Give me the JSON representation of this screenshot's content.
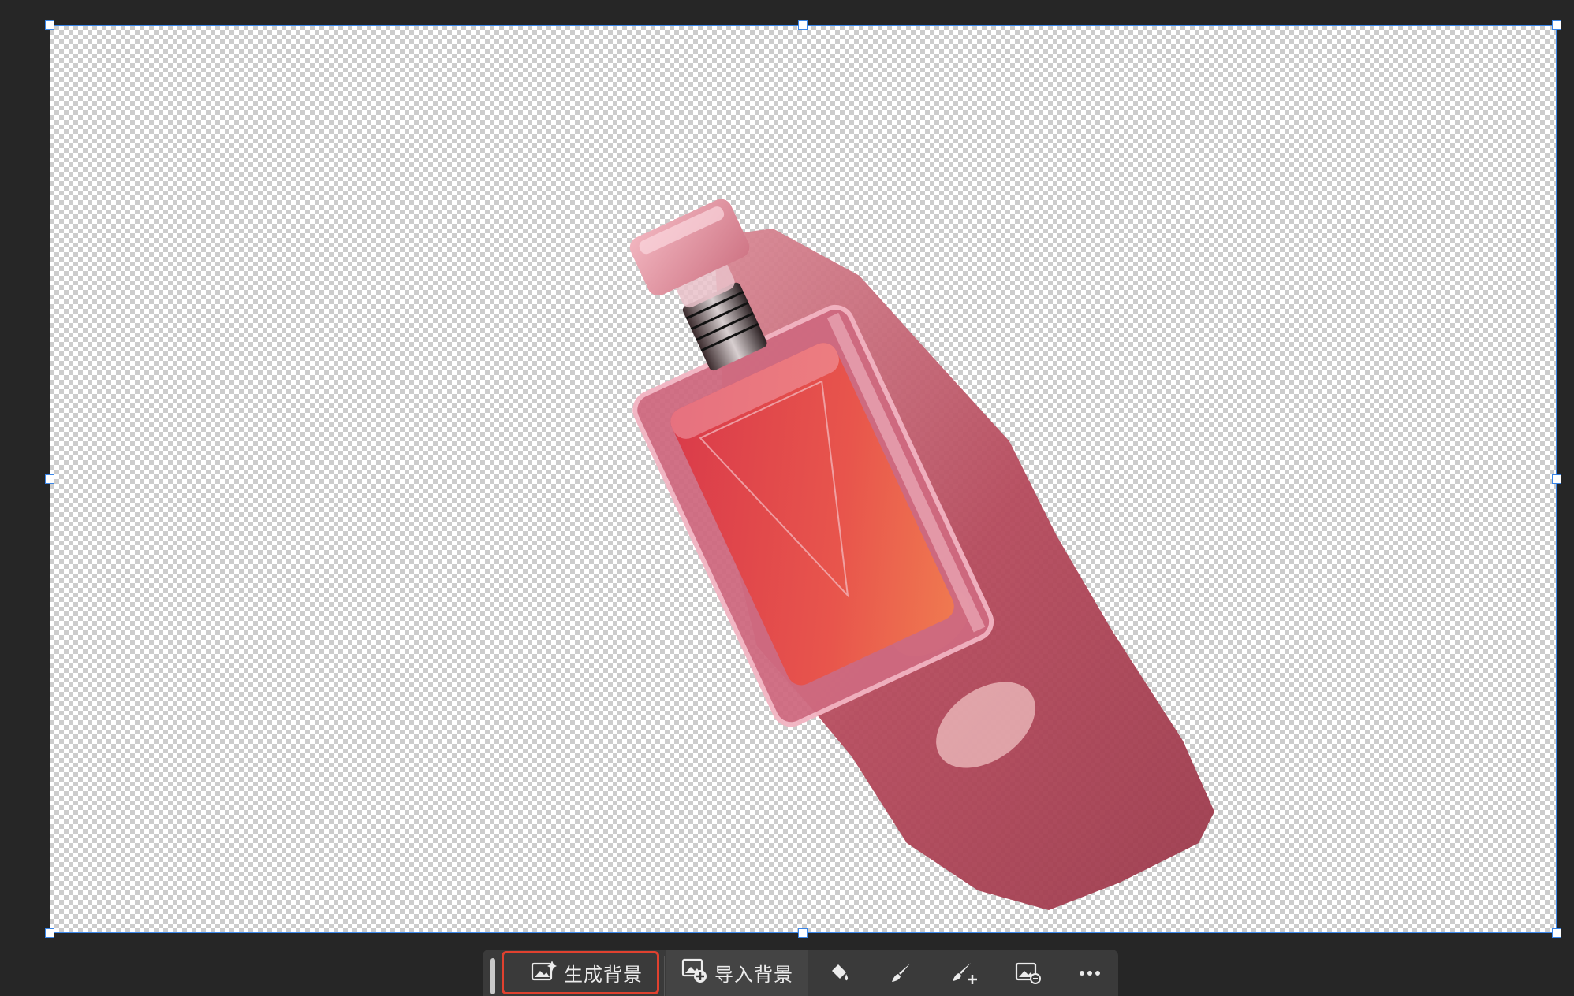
{
  "canvas": {
    "background": "transparent-checkerboard",
    "selection_color": "#3a86e8"
  },
  "toolbar": {
    "generate_background_label": "生成背景",
    "import_background_label": "导入背景",
    "highlight_color": "#e0412f",
    "tools": [
      "fill-bucket-icon",
      "brush-icon",
      "brush-add-icon",
      "image-adjust-icon",
      "more-icon"
    ]
  }
}
